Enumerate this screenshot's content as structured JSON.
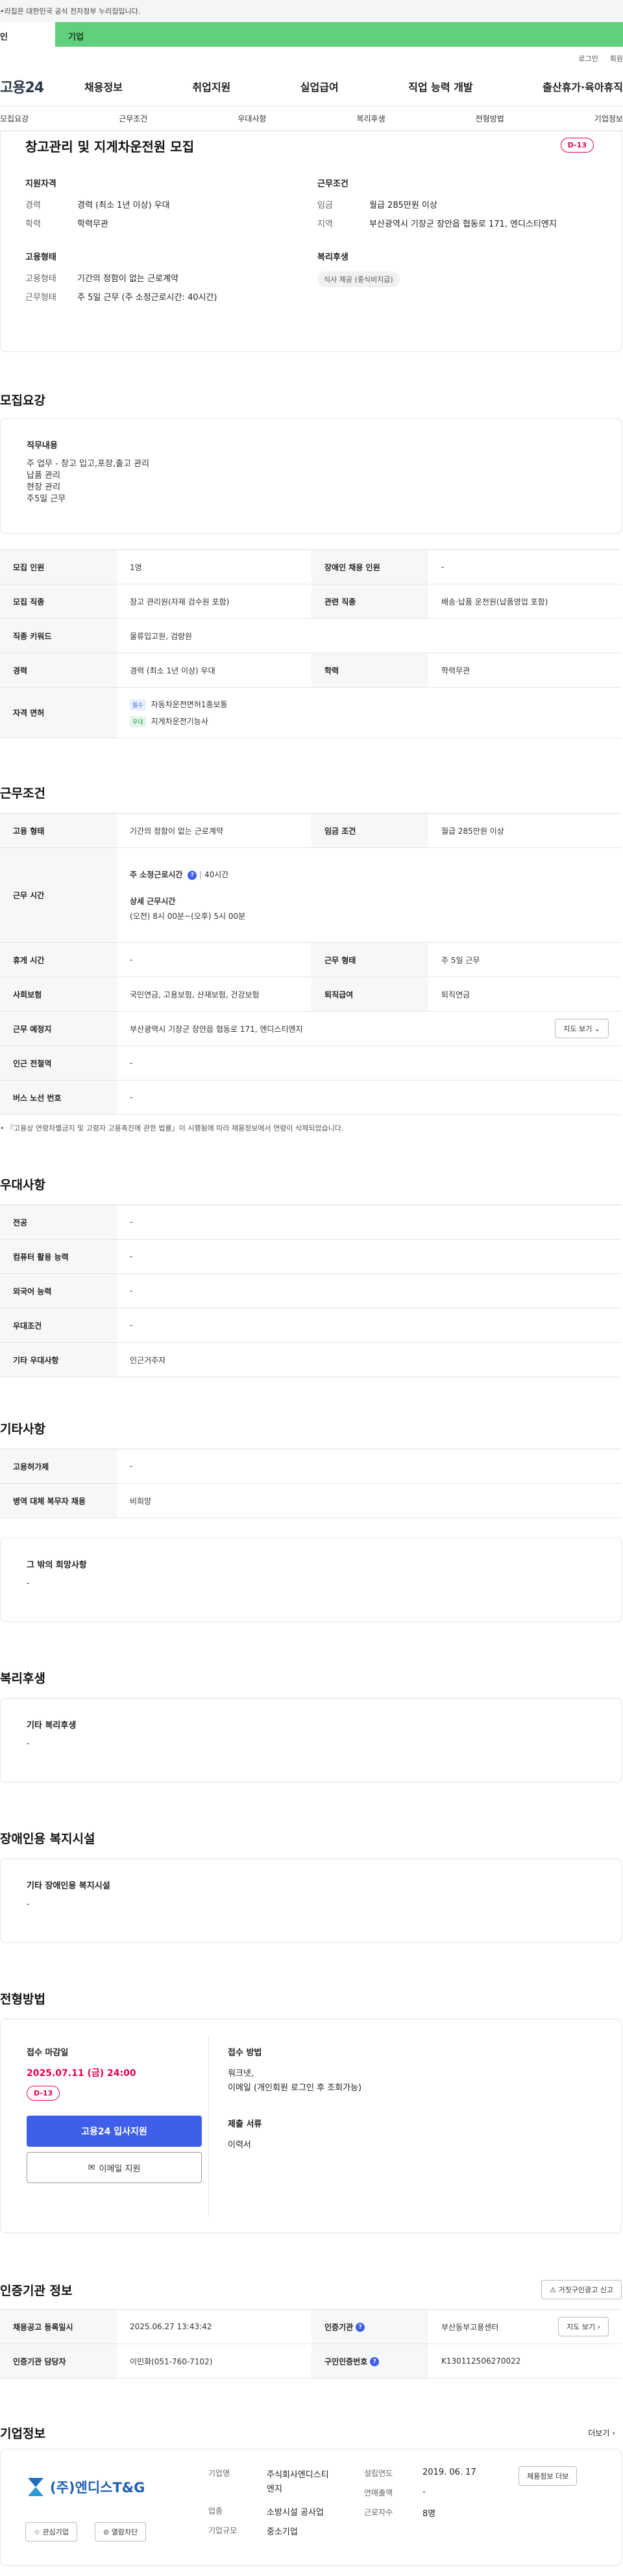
{
  "gov_notice": "•리집은 대한민국 공식 전자정부 누리집입니다.",
  "user_tabs": {
    "individual": "인",
    "corporate": "기업"
  },
  "util_links": {
    "login": "로그인",
    "signup": "회원"
  },
  "gnb": {
    "logo": "고용24",
    "menu": [
      "채용정보",
      "취업지원",
      "실업급여",
      "직업 능력 개발",
      "출산휴가·육아휴직"
    ]
  },
  "subnav": [
    "모집요강",
    "근무조건",
    "우대사항",
    "복리후생",
    "전형방법",
    "기업정보"
  ],
  "header": {
    "title": "창고관리 및 지게차운전원 모집",
    "dday": "D-13",
    "support": {
      "heading": "지원자격",
      "rows": [
        {
          "k": "경력",
          "v": "경력 (최소 1년 이상) 우대"
        },
        {
          "k": "학력",
          "v": "학력무관"
        }
      ]
    },
    "work": {
      "heading": "근무조건",
      "rows": [
        {
          "k": "임금",
          "v": "월급 285만원 이상"
        },
        {
          "k": "지역",
          "v": "부산광역시 기장군 장안읍 협동로 171, 엔디스티엔지"
        }
      ]
    },
    "employ": {
      "heading": "고용형태",
      "rows": [
        {
          "k": "고용형태",
          "v": "기간의 정함이 없는 근로계약"
        },
        {
          "k": "근무형태",
          "v": "주 5일 근무 (주 소정근로시간: 40시간)"
        }
      ]
    },
    "welfare": {
      "heading": "복리후생",
      "chip": "식사 제공 (중식비지급)"
    }
  },
  "recruit": {
    "section_title": "모집요강",
    "duty_heading": "직무내용",
    "duty_lines": [
      "주 업무 - 창고 입고,포장,출고 관리",
      "납품 관리",
      "현장 관리",
      "주5일 근무"
    ],
    "rows": {
      "headcount_k": "모집 인원",
      "headcount_v": "1명",
      "disabled_k": "장애인 채용 인원",
      "disabled_v": "-",
      "job_k": "모집 직종",
      "job_v": "창고 관리원(자재 검수원 포함)",
      "related_k": "관련 직종",
      "related_v": "배송·납품 운전원(납품영업 포함)",
      "keyword_k": "직종 키워드",
      "keyword_v": "물류입고원, 검량원",
      "career_k": "경력",
      "career_v": "경력 (최소 1년 이상) 우대",
      "edu_k": "학력",
      "edu_v": "학력무관",
      "license_k": "자격 면허",
      "license1_tag": "필수",
      "license1": "자동차운전면허1종보통",
      "license2_tag": "우대",
      "license2": "지게차운전기능사"
    }
  },
  "conditions": {
    "section_title": "근무조건",
    "emp_type_k": "고용 형태",
    "emp_type_v": "기간의 정함이 없는 근로계약",
    "wage_k": "임금 조건",
    "wage_v": "월급 285만원 이상",
    "hours_k": "근무 시간",
    "weekly_label": "주 소정근로시간",
    "weekly_v": "40시간",
    "detail_label": "상세 근무시간",
    "detail_v": "(오전) 8시 00분~(오후) 5시 00분",
    "rest_k": "휴게 시간",
    "rest_v": "-",
    "form_k": "근무 형태",
    "form_v": "주 5일 근무",
    "insurance_k": "사회보험",
    "insurance_v": "국민연금, 고용보험, 산재보험, 건강보험",
    "retire_k": "퇴직급여",
    "retire_v": "퇴직연금",
    "place_k": "근무 예정지",
    "place_v": "부산광역시 기장군 장안읍 협동로 171, 엔디스티엔지",
    "map_btn": "지도 보기",
    "subway_k": "인근 전철역",
    "subway_v": "-",
    "bus_k": "버스 노선 번호",
    "bus_v": "-",
    "note": "• 『고용상 연령차별금지 및 고령자 고용촉진에 관한 법률』이 시행됨에 따라 채용정보에서 연령이 삭제되었습니다."
  },
  "preference": {
    "section_title": "우대사항",
    "rows": [
      {
        "k": "전공",
        "v": "-"
      },
      {
        "k": "컴퓨터 활용 능력",
        "v": "-"
      },
      {
        "k": "외국어 능력",
        "v": "-"
      },
      {
        "k": "우대조건",
        "v": "-"
      },
      {
        "k": "기타 우대사항",
        "v": "인근거주자"
      }
    ]
  },
  "etc": {
    "section_title": "기타사항",
    "rows": [
      {
        "k": "고용허가제",
        "v": "-"
      },
      {
        "k": "병역 대체 복무자 채용",
        "v": "비희망"
      }
    ],
    "hope_heading": "그 밖의 희망사항",
    "hope_v": "-"
  },
  "welfare": {
    "section_title": "복리후생",
    "heading": "기타 복리후생",
    "v": "-"
  },
  "facility": {
    "section_title": "장애인용 복지시설",
    "heading": "기타 장애인용 복지시설",
    "v": "-"
  },
  "process": {
    "section_title": "전형방법",
    "deadline_label": "접수 마감일",
    "deadline": "2025.07.11 (금) 24:00",
    "dday": "D-13",
    "apply_btn": "고용24 입사지원",
    "email_btn": "이메일 지원",
    "method_label": "접수 방법",
    "method_v1": "워크넷,",
    "method_v2": "이메일 (개인회원 로그인 후 조회가능)",
    "docs_label": "제출 서류",
    "docs_v": "이력서"
  },
  "cert": {
    "section_title": "인증기관 정보",
    "report_btn": "거짓구인광고 신고",
    "date_k": "채용공고 등록일시",
    "date_v": "2025.06.27 13:43:42",
    "org_k": "인증기관",
    "org_v": "부산동부고용센터",
    "map_btn": "지도 보기",
    "manager_k": "인증기관 담당자",
    "manager_v": "이민화(051-760-7102)",
    "num_k": "구인인증번호",
    "num_v": "K130112506270022"
  },
  "company": {
    "section_title": "기업정보",
    "more": "더보기",
    "logo_text": "(주)엔디스T&G",
    "follow_btn": "관심기업",
    "block_btn": "열람차단",
    "name_k": "기업명",
    "name_v1": "주식회사엔디스티",
    "name_v2": "엔지",
    "industry_k": "업종",
    "industry_v": "소방시설 공사업",
    "scale_k": "기업규모",
    "scale_v": "중소기업",
    "founded_k": "설립연도",
    "founded_v": "2019. 06. 17",
    "sales_k": "연매출액",
    "sales_v": "-",
    "employees_k": "근로자수",
    "employees_v": "8명",
    "hire_btn": "채용정보 더보"
  },
  "colors": {
    "accent": "#3f5fea",
    "dday": "#e6004c",
    "corp_tab": "#61cf7b"
  }
}
